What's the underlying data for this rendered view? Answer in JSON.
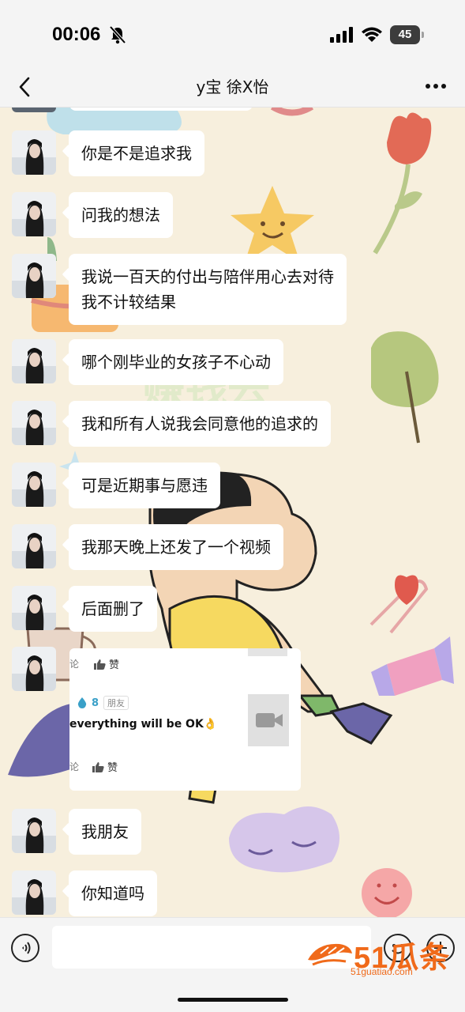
{
  "status_bar": {
    "time": "00:06",
    "battery": "45"
  },
  "nav": {
    "title": "y宝 徐X怡"
  },
  "messages": [
    {
      "text": "你是不是追求我"
    },
    {
      "text": "问我的想法"
    },
    {
      "text": "我说一百天的付出与陪伴用心去对待"
    },
    {
      "text": "我不计较结果"
    },
    {
      "text": "哪个刚毕业的女孩子不心动"
    },
    {
      "text": "我和所有人说我会同意他的追求的"
    },
    {
      "text": "可是近期事与愿违"
    },
    {
      "text": "我那天晚上还发了一个视频"
    },
    {
      "text": "后面删了"
    },
    {
      "text": "我朋友"
    },
    {
      "text": "你知道吗"
    }
  ],
  "shared_card": {
    "like_label": "赞",
    "comment_partial": "论",
    "level": "8",
    "tag": "朋友",
    "post_text": "everything will be OK👌"
  },
  "watermark": {
    "big": "51瓜条",
    "small": "51guatiao.com"
  },
  "colors": {
    "bubble": "#ffffff",
    "wallpaper": "#f7efdd",
    "watermark": "#f06a1a"
  }
}
